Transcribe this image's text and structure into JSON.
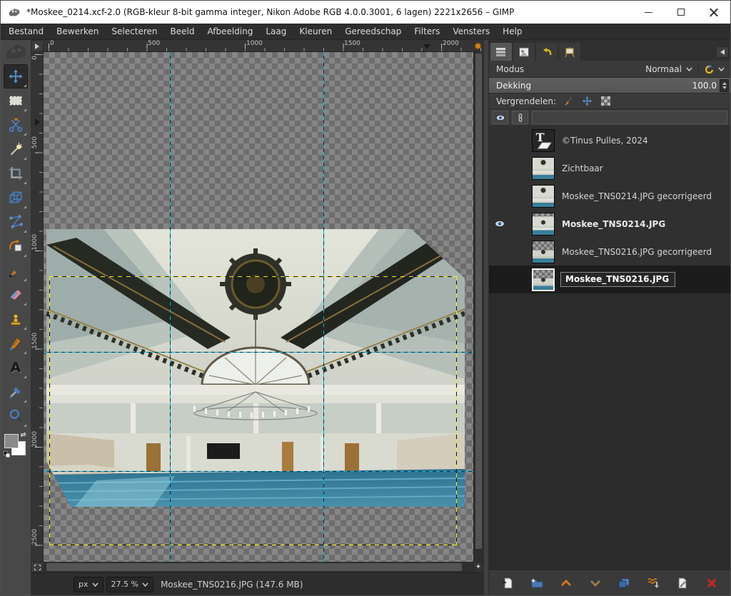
{
  "window": {
    "title": "*Moskee_0214.xcf-2.0 (RGB-kleur 8-bit gamma integer, Nikon Adobe RGB 4.0.0.3001, 6 lagen) 2221x2656 – GIMP"
  },
  "menu": {
    "items": [
      "Bestand",
      "Bewerken",
      "Selecteren",
      "Beeld",
      "Afbeelding",
      "Laag",
      "Kleuren",
      "Gereedschap",
      "Filters",
      "Vensters",
      "Help"
    ]
  },
  "toolbox": {
    "tools": [
      "move",
      "rectangle-select",
      "scissors-select",
      "fuzzy-select",
      "crop",
      "unified-transform",
      "handle-transform",
      "warp-transform",
      "paintbrush",
      "eraser",
      "clone-stamp",
      "ink",
      "text",
      "color-picker",
      "zoom"
    ],
    "selected_tool": "move"
  },
  "rulers": {
    "horizontal": [
      "0",
      "500",
      "1000",
      "1500",
      "2000"
    ],
    "vertical": [
      "0",
      "500",
      "1000",
      "1500",
      "2000",
      "2500"
    ]
  },
  "layers_panel": {
    "mode_label": "Modus",
    "mode_value": "Normaal",
    "opacity_label": "Dekking",
    "opacity_value": "100.0",
    "lock_label": "Vergrendelen:",
    "layers": [
      {
        "name": "©Tinus Pulles, 2024",
        "type": "text",
        "visible": false,
        "selected": false
      },
      {
        "name": "Zichtbaar",
        "type": "image",
        "visible": false,
        "selected": false
      },
      {
        "name": "Moskee_TNS0214.JPG gecorrigeerd",
        "type": "image",
        "visible": false,
        "selected": false
      },
      {
        "name": "Moskee_TNS0214.JPG",
        "type": "image",
        "visible": true,
        "selected": false
      },
      {
        "name": "Moskee_TNS0216.JPG gecorrigeerd",
        "type": "image",
        "visible": false,
        "selected": false
      },
      {
        "name": "Moskee_TNS0216.JPG",
        "type": "image",
        "visible": false,
        "selected": true
      }
    ]
  },
  "statusbar": {
    "unit": "px",
    "zoom": "27.5 %",
    "message": "Moskee_TNS0216.JPG (147.6 MB)"
  },
  "colors": {
    "guide": "#00b8e8",
    "layer_boundary": "#f6ec13",
    "accent_orange": "#d08018",
    "selection_row": "#1c1c1c"
  }
}
